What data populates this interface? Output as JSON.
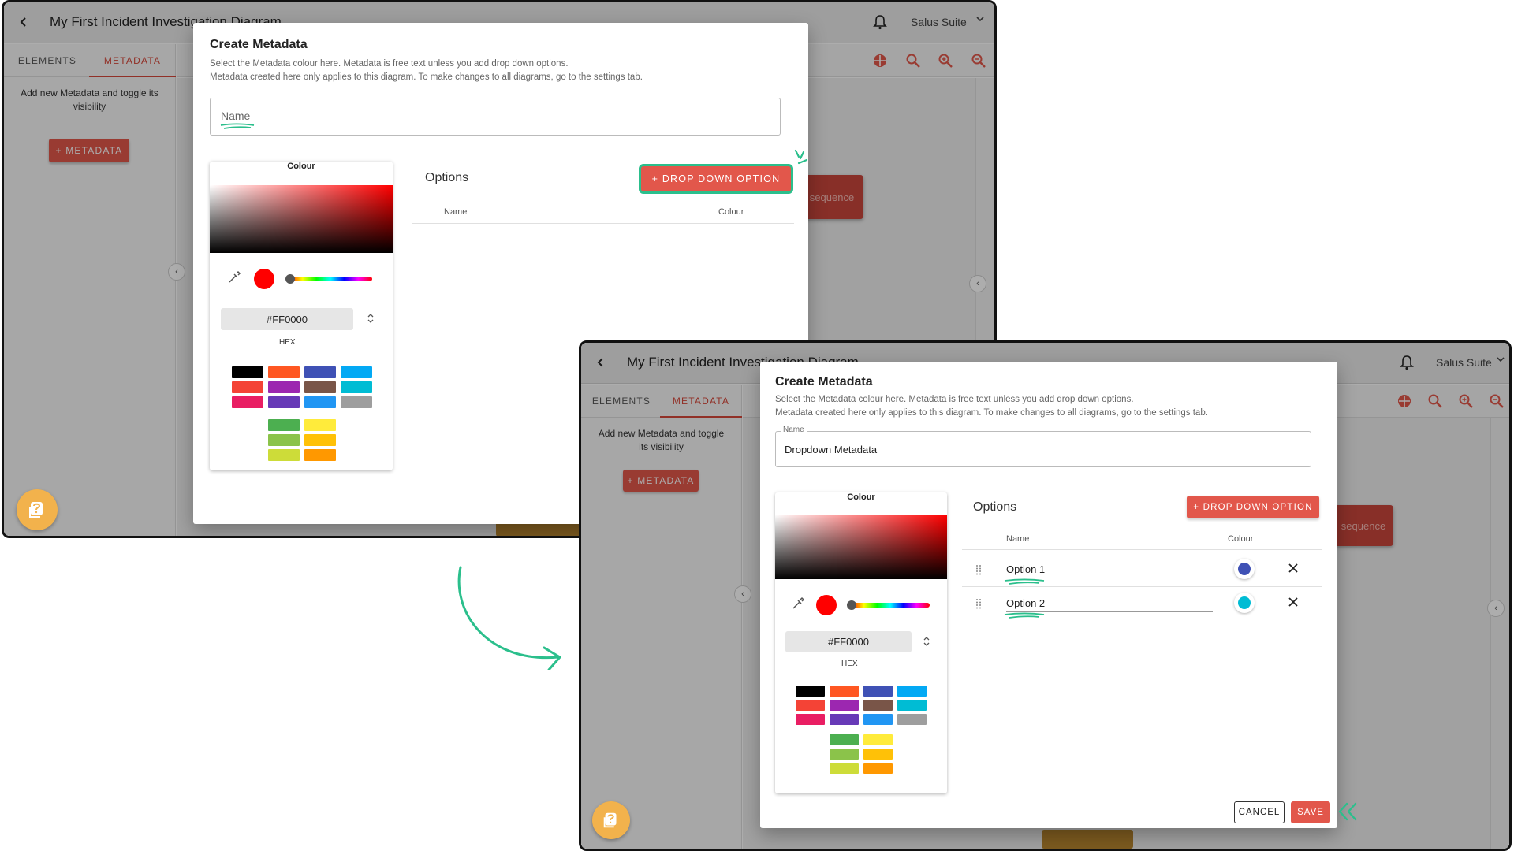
{
  "app": {
    "title": "My First Incident Investigation Diagram",
    "suite": "Salus Suite"
  },
  "sidebar": {
    "tabs": [
      "ELEMENTS",
      "METADATA"
    ],
    "active_tab": "METADATA",
    "hint": "Add new Metadata and toggle its visibility",
    "add_button": "+ METADATA"
  },
  "canvas": {
    "sequence_block": "sequence"
  },
  "dialog": {
    "title": "Create Metadata",
    "subtitle_line1": "Select the Metadata colour here. Metadata is free text unless you add drop down options.",
    "subtitle_line2": "Metadata created here only applies to this diagram. To make changes to all diagrams, go to the settings tab.",
    "name_placeholder": "Name",
    "name_legend": "Name",
    "name_value": "Dropdown Metadata",
    "colour_label": "Colour",
    "hex_value": "#FF0000",
    "hex_label": "HEX",
    "options_title": "Options",
    "dropdown_button": "+ DROP DOWN OPTION",
    "col_name": "Name",
    "col_colour": "Colour",
    "options": [
      {
        "name": "Option 1",
        "colour": "#3f51b5"
      },
      {
        "name": "Option 2",
        "colour": "#00bcd4"
      }
    ],
    "cancel": "CANCEL",
    "save": "SAVE"
  },
  "swatches": {
    "grid": [
      "#000000",
      "#ff5722",
      "#3f51b5",
      "#03a9f4",
      "#f44336",
      "#9c27b0",
      "#795548",
      "#00bcd4",
      "#e91e63",
      "#673ab7",
      "#2196f3",
      "#9e9e9e"
    ],
    "extra": [
      "#4caf50",
      "#ffeb3b",
      "#8bc34a",
      "#ffc107",
      "#cddc39",
      "#ff9800"
    ]
  },
  "colors": {
    "accent": "#e2574b",
    "annotation": "#2bbf8c",
    "selected": "#ff0000"
  }
}
